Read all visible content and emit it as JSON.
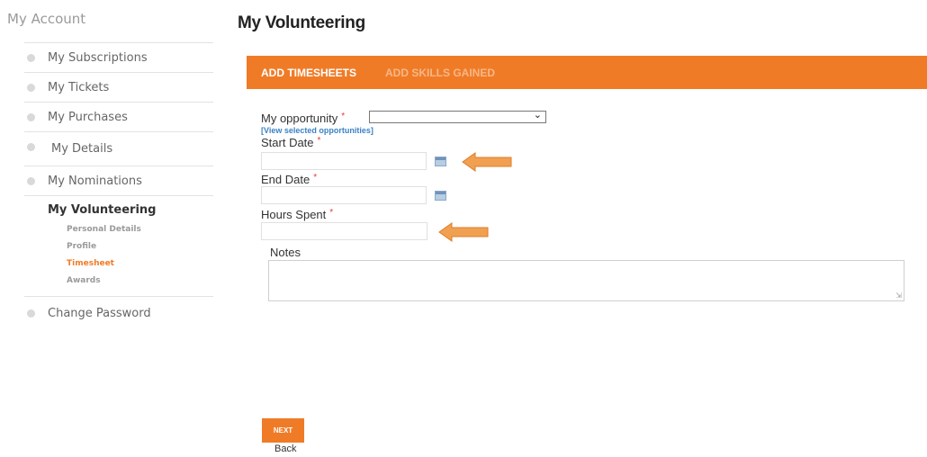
{
  "sidebar": {
    "title": "My Account",
    "items_top": [
      {
        "label": "My Subscriptions"
      },
      {
        "label": "My Tickets"
      },
      {
        "label": "My Purchases"
      },
      {
        "label": "My Details"
      },
      {
        "label": "My Nominations"
      }
    ],
    "group": {
      "title": "My Volunteering",
      "subitems": [
        {
          "label": "Personal Details"
        },
        {
          "label": "Profile"
        },
        {
          "label": "Timesheet",
          "active": true
        },
        {
          "label": "Awards"
        }
      ]
    },
    "items_bottom": [
      {
        "label": "Change Password"
      }
    ]
  },
  "main": {
    "title": "My Volunteering",
    "tabs": [
      {
        "label": "ADD TIMESHEETS",
        "active": true
      },
      {
        "label": "ADD SKILLS GAINED",
        "active": false
      }
    ],
    "form": {
      "opportunity_label": "My opportunity",
      "opportunity_value": "",
      "view_link": "[View selected opportunities]",
      "start_date_label": "Start Date",
      "start_date_value": "",
      "end_date_label": "End Date",
      "end_date_value": "",
      "hours_label": "Hours Spent",
      "hours_value": "",
      "notes_label": "Notes",
      "notes_value": "",
      "required_marker": "*"
    },
    "actions": {
      "next_label": "NEXT",
      "back_label": "Back"
    }
  },
  "colors": {
    "accent": "#f07b27",
    "link": "#3b82c4",
    "required": "#e53935"
  }
}
